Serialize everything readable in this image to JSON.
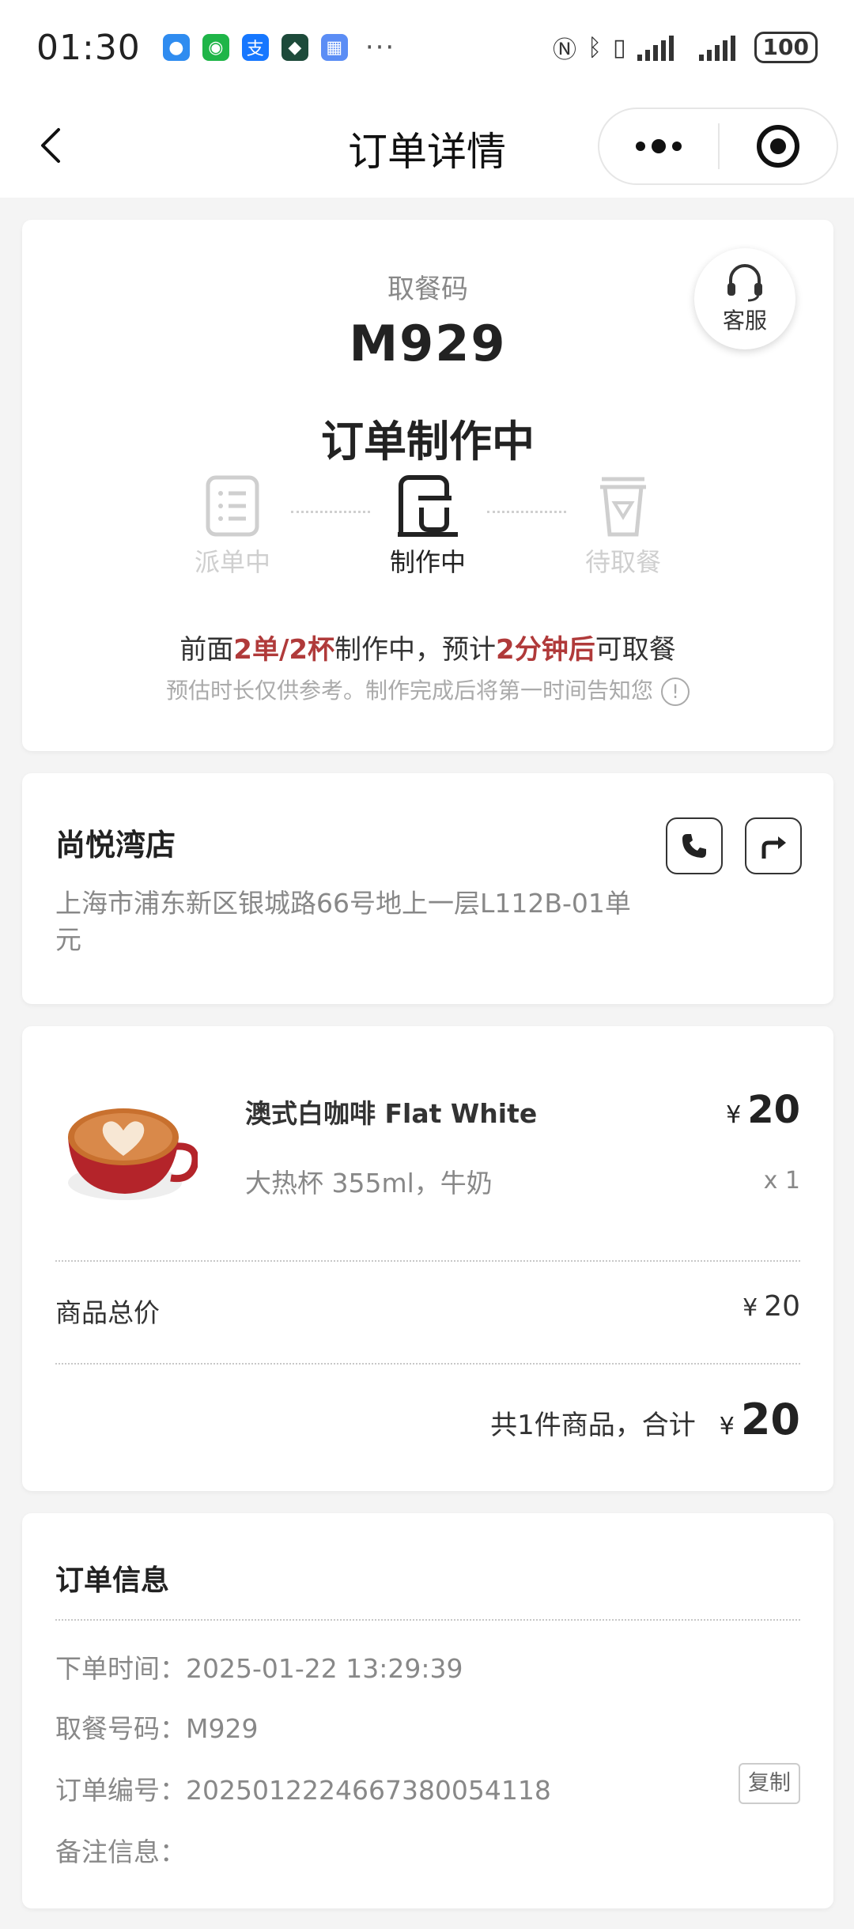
{
  "status_bar": {
    "time": "01:30",
    "more": "···",
    "battery": "100",
    "icons": [
      "message-icon",
      "wechat-icon",
      "alipay-icon",
      "app-icon",
      "calendar-icon",
      "nfc-icon",
      "bluetooth-icon",
      "vibrate-icon",
      "signal-icon",
      "signal-icon"
    ]
  },
  "nav": {
    "title": "订单详情"
  },
  "order_status": {
    "pickup_label": "取餐码",
    "pickup_code": "M929",
    "title": "订单制作中",
    "customer_service": "客服",
    "steps": [
      {
        "label": "派单中",
        "active": false
      },
      {
        "label": "制作中",
        "active": true
      },
      {
        "label": "待取餐",
        "active": false
      }
    ],
    "queue": {
      "p1": "前面",
      "h1": "2单/2杯",
      "p2": "制作中，预计",
      "h2": "2分钟后",
      "p3": "可取餐"
    },
    "note": "预估时长仅供参考。制作完成后将第一时间告知您",
    "note_icon": "!"
  },
  "store": {
    "name": "尚悦湾店",
    "address": "上海市浦东新区银城路66号地上一层L112B-01单元"
  },
  "items": {
    "product": {
      "name": "澳式白咖啡 Flat White",
      "spec": "大热杯 355ml，牛奶",
      "currency": "¥",
      "price": "20",
      "qty": "x 1"
    },
    "total_label": "商品总价",
    "total_value": "20",
    "summary": "共1件商品，合计",
    "final_amount": "20"
  },
  "order_info": {
    "title": "订单信息",
    "rows": [
      {
        "label": "下单时间：",
        "value": "2025-01-22 13:29:39"
      },
      {
        "label": "取餐号码：",
        "value": "M929"
      },
      {
        "label": "订单编号：",
        "value": "20250122246673800541​18"
      },
      {
        "label": "备注信息：",
        "value": ""
      }
    ],
    "copy": "复制"
  },
  "colors": {
    "accent_red": "#b03a3a",
    "background": "#f4f4f4",
    "muted": "#888888"
  }
}
